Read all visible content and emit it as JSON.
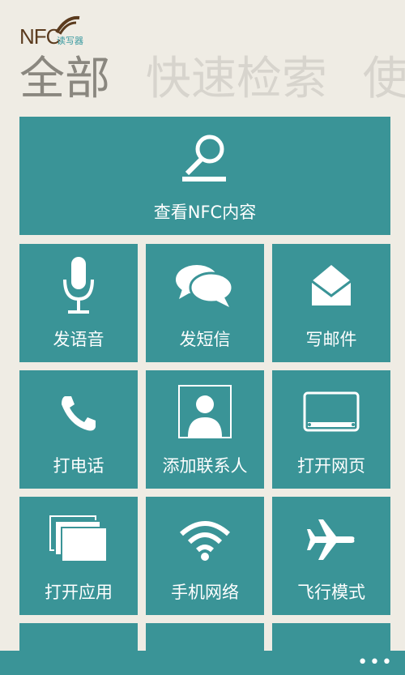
{
  "app": {
    "logo_text": "NFC",
    "logo_sub": "读写器"
  },
  "pivot": {
    "items": [
      "全部",
      "快速检索",
      "使"
    ]
  },
  "tiles": {
    "view": "查看NFC内容",
    "voice": "发语音",
    "sms": "发短信",
    "email": "写邮件",
    "call": "打电话",
    "contact": "添加联系人",
    "web": "打开网页",
    "app": "打开应用",
    "network": "手机网络",
    "airplane": "飞行模式"
  },
  "appbar": {
    "more": "•••"
  },
  "colors": {
    "tile": "#3a9497",
    "background": "#efece4"
  }
}
